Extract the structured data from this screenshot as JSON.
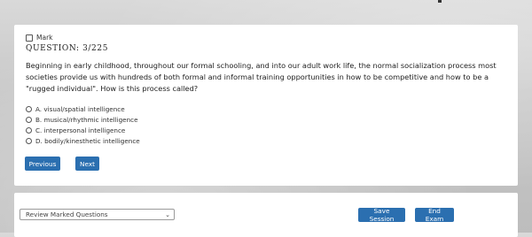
{
  "question": {
    "mark_label": "Mark",
    "number_text": "QUESTION: 3/225",
    "text": "Beginning in early childhood, throughout our formal schooling, and into our adult work life, the normal socialization process most societies provide us with hundreds of both formal and informal training opportunities in how to be competitive and how to be a \"rugged individual\". How is this process called?",
    "options": [
      {
        "label": "A. visual/spatial intelligence"
      },
      {
        "label": "B. musical/rhythmic intelligence"
      },
      {
        "label": "C. interpersonal intelligence"
      },
      {
        "label": "D. bodily/kinesthetic intelligence"
      }
    ]
  },
  "navigation": {
    "previous_label": "Previous",
    "next_label": "Next"
  },
  "footer": {
    "review_select_value": "Review Marked Questions",
    "save_label": "Save Session",
    "end_label": "End Exam"
  },
  "colors": {
    "accent": "#2b6fb0",
    "background": "#c8c8c8"
  }
}
